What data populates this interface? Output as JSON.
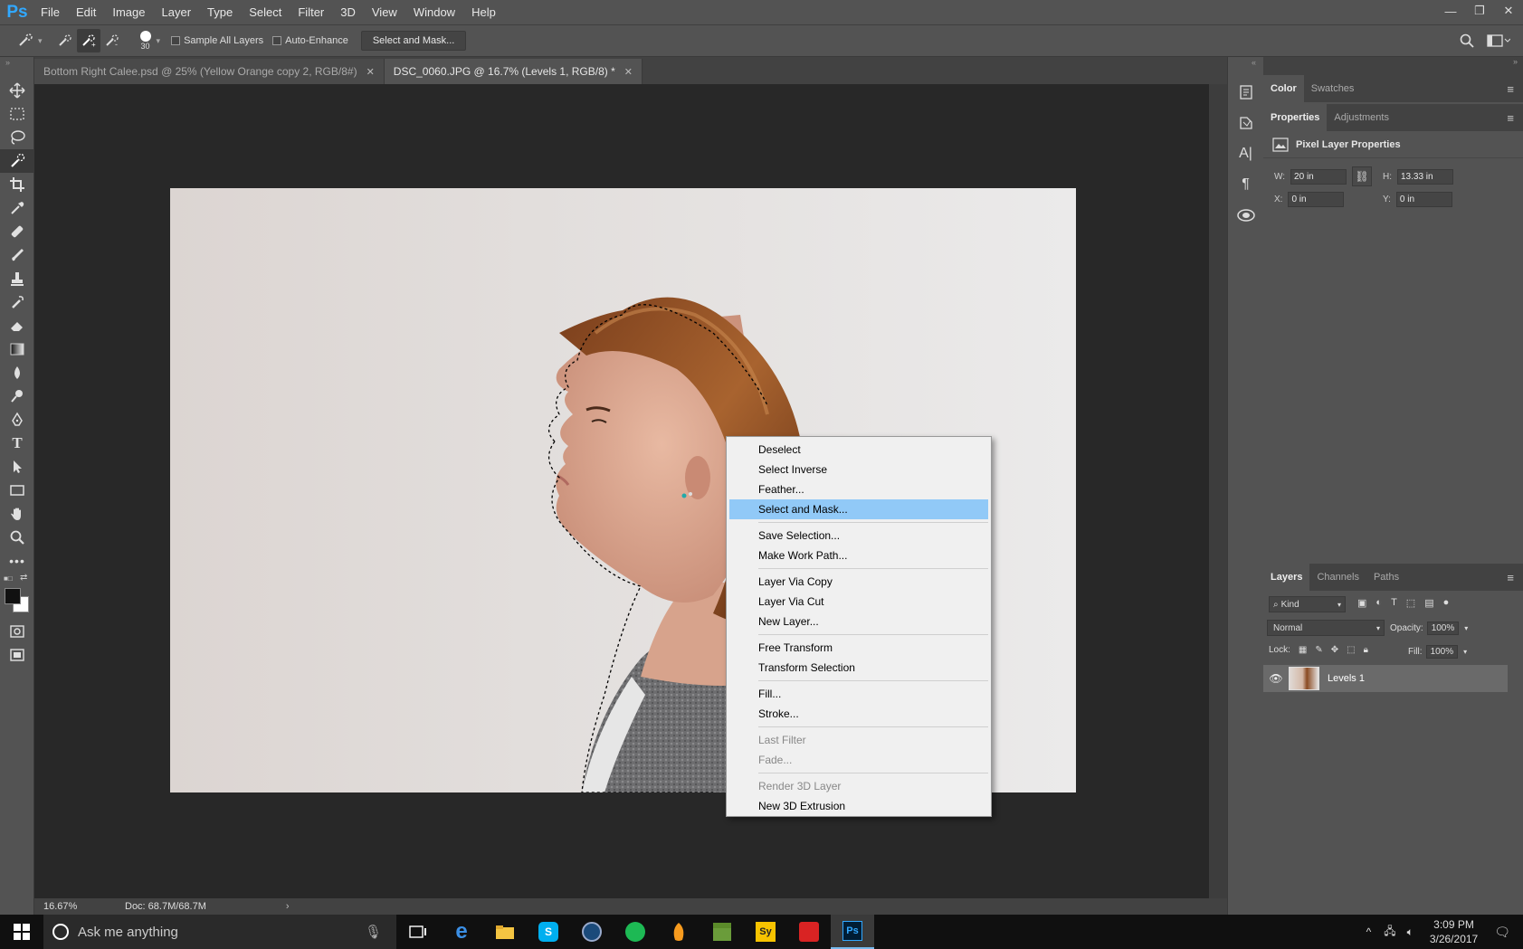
{
  "app": {
    "logo": "Ps"
  },
  "menubar": {
    "items": [
      "File",
      "Edit",
      "Image",
      "Layer",
      "Type",
      "Select",
      "Filter",
      "3D",
      "View",
      "Window",
      "Help"
    ]
  },
  "window_controls": [
    "minimize-icon",
    "restore-icon",
    "close-icon"
  ],
  "options_bar": {
    "brush_size": "30",
    "sample_all_layers": "Sample All Layers",
    "auto_enhance": "Auto-Enhance",
    "select_and_mask": "Select and Mask..."
  },
  "tabs": [
    {
      "label": "Bottom Right Calee.psd @ 25% (Yellow Orange copy 2, RGB/8#)",
      "active": false
    },
    {
      "label": "DSC_0060.JPG @ 16.7% (Levels 1, RGB/8) *",
      "active": true
    }
  ],
  "status": {
    "zoom": "16.67%",
    "doc": "Doc: 68.7M/68.7M"
  },
  "context_menu": {
    "items": [
      {
        "label": "Deselect"
      },
      {
        "label": "Select Inverse"
      },
      {
        "label": "Feather..."
      },
      {
        "label": "Select and Mask...",
        "highlighted": true
      },
      {
        "separator": true
      },
      {
        "label": "Save Selection..."
      },
      {
        "label": "Make Work Path..."
      },
      {
        "separator": true
      },
      {
        "label": "Layer Via Copy"
      },
      {
        "label": "Layer Via Cut"
      },
      {
        "label": "New Layer..."
      },
      {
        "separator": true
      },
      {
        "label": "Free Transform"
      },
      {
        "label": "Transform Selection"
      },
      {
        "separator": true
      },
      {
        "label": "Fill..."
      },
      {
        "label": "Stroke..."
      },
      {
        "separator": true
      },
      {
        "label": "Last Filter",
        "disabled": true
      },
      {
        "label": "Fade...",
        "disabled": true
      },
      {
        "separator": true
      },
      {
        "label": "Render 3D Layer",
        "disabled": true
      },
      {
        "label": "New 3D Extrusion"
      }
    ]
  },
  "color_panel": {
    "tabs": [
      "Color",
      "Swatches"
    ]
  },
  "properties_panel": {
    "tabs": [
      "Properties",
      "Adjustments"
    ],
    "title": "Pixel Layer Properties",
    "w_label": "W:",
    "w": "20 in",
    "h_label": "H:",
    "h": "13.33 in",
    "x_label": "X:",
    "x": "0 in",
    "y_label": "Y:",
    "y": "0 in"
  },
  "layers_panel": {
    "tabs": [
      "Layers",
      "Channels",
      "Paths"
    ],
    "filter_kind": "Kind",
    "blend_mode": "Normal",
    "opacity_label": "Opacity:",
    "opacity": "100%",
    "lock_label": "Lock:",
    "fill_label": "Fill:",
    "fill": "100%",
    "layers": [
      {
        "name": "Levels 1",
        "visible": true
      }
    ]
  },
  "taskbar": {
    "search_placeholder": "Ask me anything",
    "time": "3:09 PM",
    "date": "3/26/2017"
  }
}
